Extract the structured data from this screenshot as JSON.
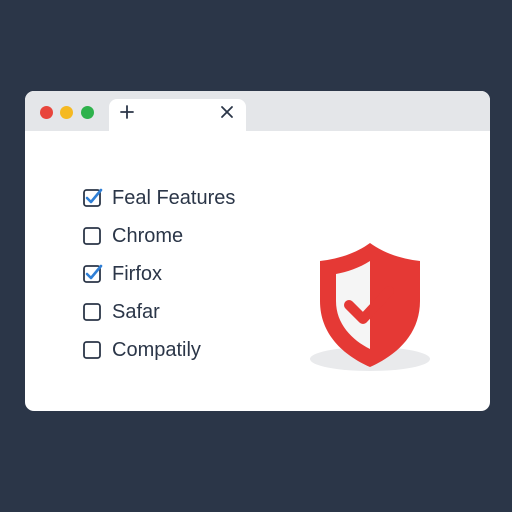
{
  "browser": {
    "window_controls": [
      "close",
      "minimize",
      "maximize"
    ],
    "tab": {
      "new_tab_icon": "plus-icon",
      "close_icon": "close-icon"
    }
  },
  "checklist": {
    "items": [
      {
        "label": "Feal Features",
        "checked": true
      },
      {
        "label": "Chrome",
        "checked": false
      },
      {
        "label": "Firfox",
        "checked": true
      },
      {
        "label": "Safar",
        "checked": false
      },
      {
        "label": "Compatily",
        "checked": false
      }
    ]
  },
  "illustration": {
    "icon": "shield-check-icon",
    "colors": {
      "shield": "#e53935",
      "shield_inner": "#f5f5f5",
      "check": "#e53935",
      "checkbox_mark": "#2f7fd6"
    }
  }
}
